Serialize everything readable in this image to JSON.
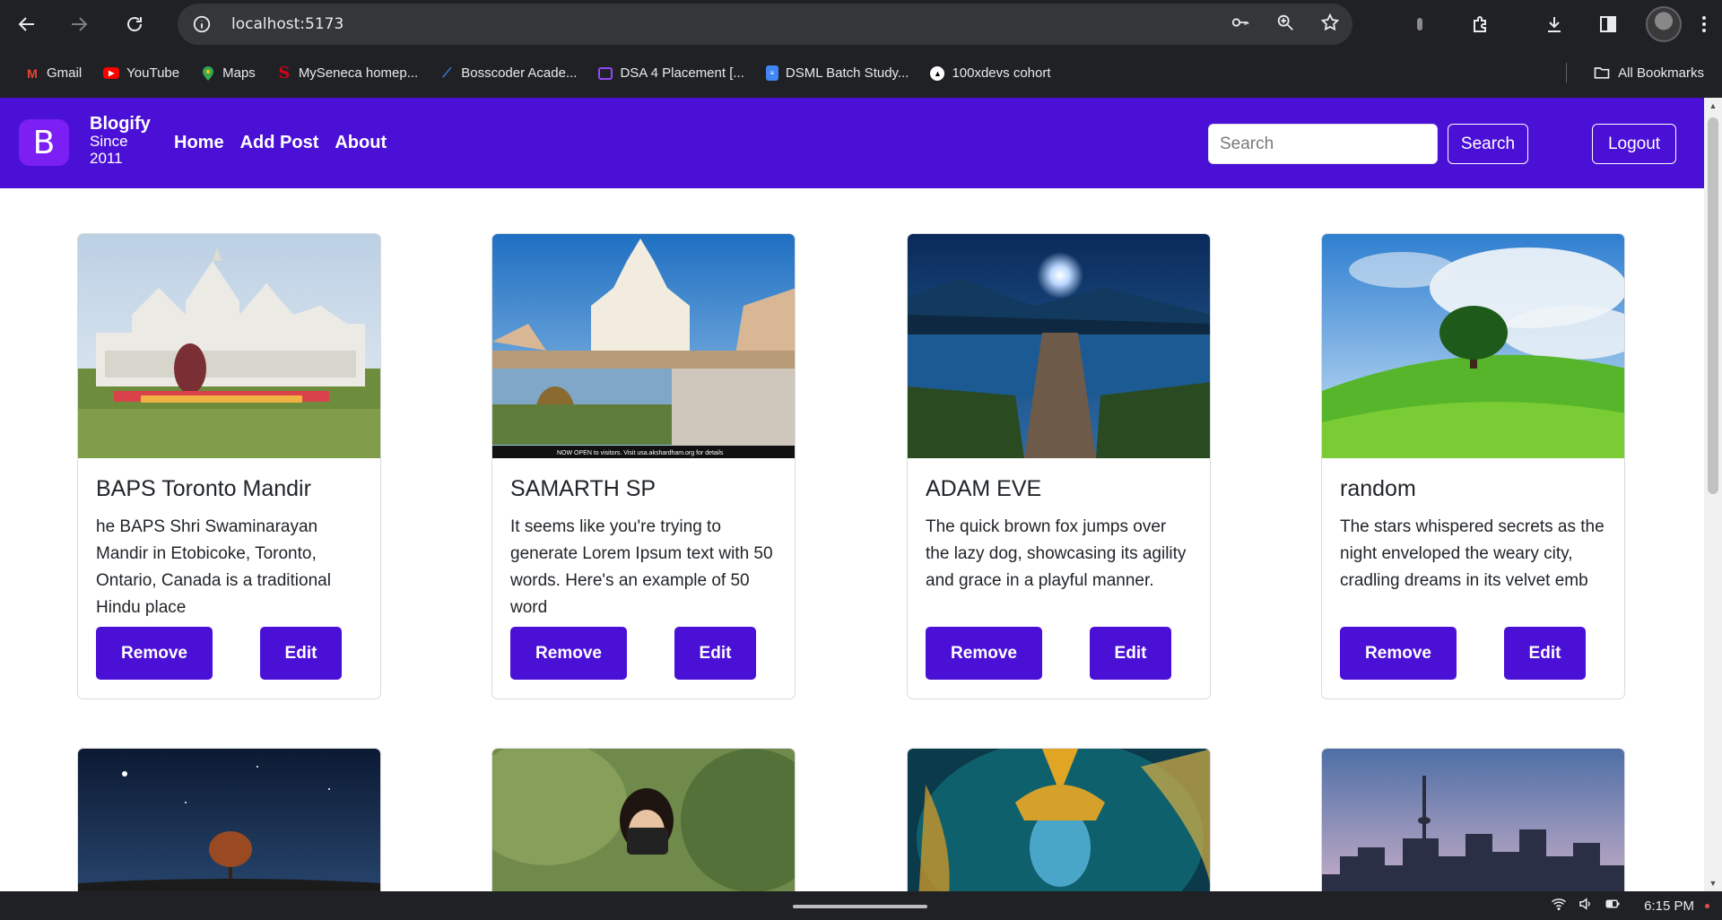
{
  "browser": {
    "url": "localhost:5173",
    "bookmarks": [
      {
        "label": "Gmail",
        "icon": "gmail-icon",
        "color": "#ea4335"
      },
      {
        "label": "YouTube",
        "icon": "youtube-icon",
        "color": "#ff0000"
      },
      {
        "label": "Maps",
        "icon": "maps-icon",
        "color": "#34a853"
      },
      {
        "label": "MySeneca homep...",
        "icon": "seneca-icon",
        "color": "#d0021b"
      },
      {
        "label": "Bosscoder Acade...",
        "icon": "bosscoder-icon",
        "color": "#3b82f6"
      },
      {
        "label": "DSA 4 Placement [...",
        "icon": "twitch-icon",
        "color": "#9146ff"
      },
      {
        "label": "DSML Batch Study...",
        "icon": "docs-icon",
        "color": "#4285f4"
      },
      {
        "label": "100xdevs cohort",
        "icon": "triangle-icon",
        "color": "#ffffff"
      }
    ],
    "all_bookmarks": "All Bookmarks"
  },
  "app": {
    "brand": {
      "logo": "B",
      "name": "Blogify",
      "since": "Since 2011"
    },
    "nav": [
      {
        "label": "Home"
      },
      {
        "label": "Add Post"
      },
      {
        "label": "About"
      }
    ],
    "search": {
      "placeholder": "Search",
      "button": "Search"
    },
    "logout": "Logout",
    "cards": [
      {
        "title": "BAPS Toronto Mandir",
        "text": "he BAPS Shri Swaminarayan Mandir in Etobicoke, Toronto, Ontario, Canada is a traditional Hindu place",
        "remove": "Remove",
        "edit": "Edit",
        "image": "white-temple-photo"
      },
      {
        "title": "SAMARTH SP",
        "text": "It seems like you're trying to generate Lorem Ipsum text with 50 words. Here's an example of 50 word",
        "remove": "Remove",
        "edit": "Edit",
        "image": "akshardham-temple-photo",
        "image_caption": "NOW OPEN to visitors. Visit usa.akshardham.org for details"
      },
      {
        "title": "ADAM EVE",
        "text": "The quick brown fox jumps over the lazy dog, showcasing its agility and grace in a playful manner.",
        "remove": "Remove",
        "edit": "Edit",
        "image": "lake-pier-night-photo"
      },
      {
        "title": "random",
        "text": "The stars whispered secrets as the night enveloped the weary city, cradling dreams in its velvet emb",
        "remove": "Remove",
        "edit": "Edit",
        "image": "green-hill-tree-photo"
      }
    ],
    "second_row_images": [
      "night-sky-tree-photo",
      "photographer-photo",
      "krishna-art-photo",
      "toronto-skyline-photo"
    ]
  },
  "taskbar": {
    "time": "6:15 PM"
  }
}
